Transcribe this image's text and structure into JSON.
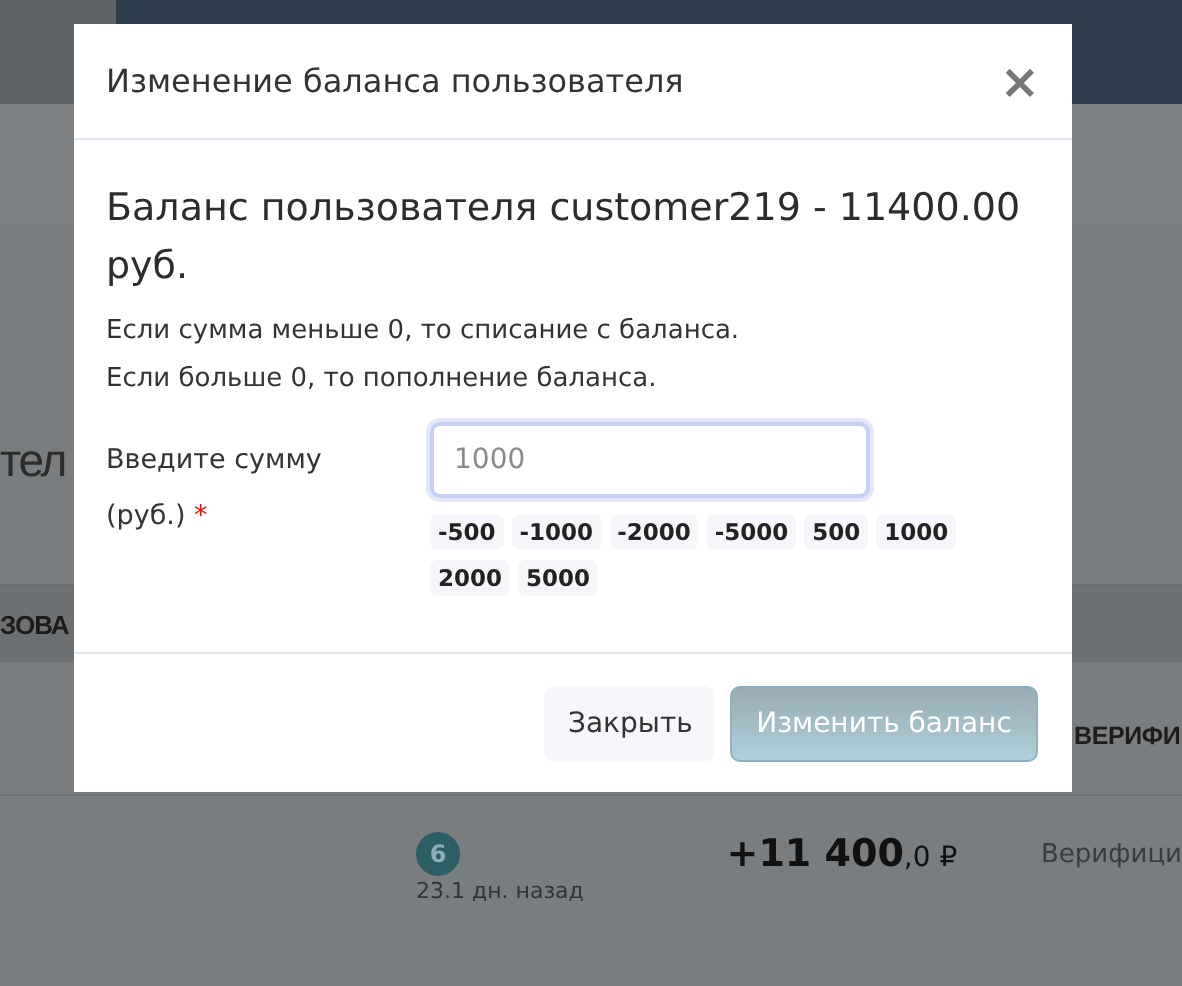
{
  "background": {
    "heading_fragment": "тел",
    "table_header_left": "ЗОВА",
    "table_header_right": "ВЕРИФИ",
    "row": {
      "badge": "6",
      "time": "23.1 дн. назад",
      "amount": "+11 400",
      "amount_fraction": ",0 ₽",
      "status": "Верифици"
    }
  },
  "modal": {
    "title": "Изменение баланса пользователя",
    "close": "×",
    "heading": "Баланс пользователя customer219 - 11400.00 руб.",
    "notes": [
      "Если сумма меньше 0, то списание с баланса.",
      "Если больше 0, то пополнение баланса."
    ],
    "field": {
      "label": "Введите сумму (руб.)",
      "required": true,
      "required_mark": "*",
      "placeholder": "1000",
      "focused": true
    },
    "quick_amounts": [
      "-500",
      "-1000",
      "-2000",
      "-5000",
      "500",
      "1000",
      "2000",
      "5000"
    ],
    "buttons": [
      {
        "label": "Закрыть",
        "kind": "secondary"
      },
      {
        "label": "Изменить баланс",
        "kind": "primary"
      }
    ]
  }
}
